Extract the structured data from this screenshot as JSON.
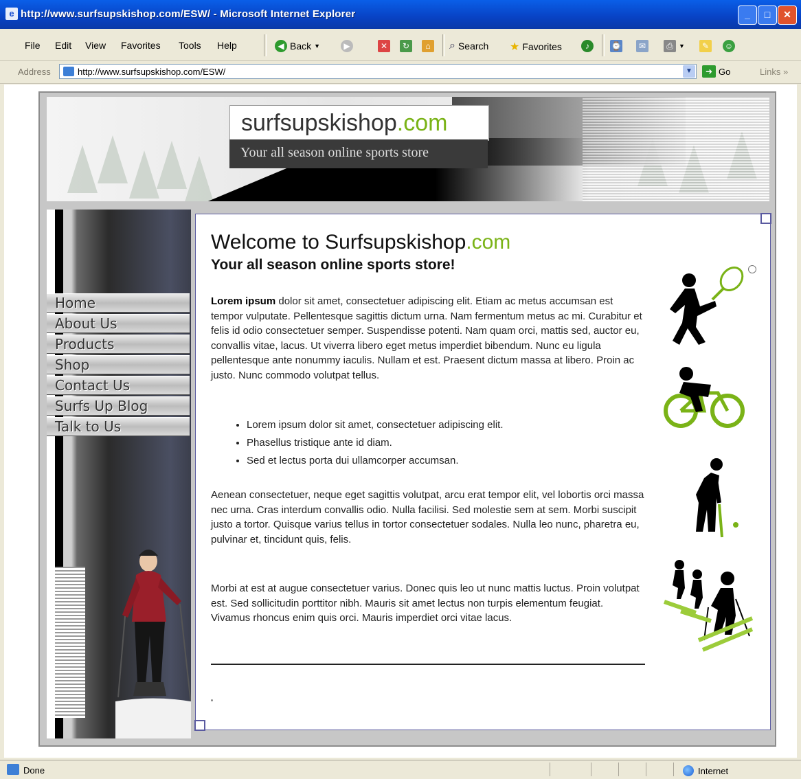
{
  "window": {
    "title": "http://www.surfsupskishop.com/ESW/ - Microsoft Internet Explorer",
    "min_symbol": "_",
    "max_symbol": "□",
    "close_symbol": "✕"
  },
  "menu": [
    "File",
    "Edit",
    "View",
    "Favorites",
    "Tools",
    "Help"
  ],
  "toolbar": {
    "back_label": "Back",
    "search_label": "Search",
    "favorites_label": "Favorites"
  },
  "address": {
    "label": "Address",
    "url": "http://www.surfsupskishop.com/ESW/",
    "go_label": "Go",
    "links_label": "Links"
  },
  "site": {
    "logo_name": "surfsupskishop",
    "logo_tld": ".com",
    "tagline": "Your all season online sports store",
    "nav": [
      "Home",
      "About Us",
      "Products",
      "Shop",
      "Contact Us",
      "Surfs Up Blog",
      "Talk to Us"
    ],
    "heading_prefix": "Welcome to Surfsupskishop",
    "heading_tld": ".com",
    "subheading": "Your all season online sports store!",
    "p1_bold": "Lorem ipsum",
    "p1_rest": " dolor sit amet, consectetuer adipiscing elit. Etiam ac metus accumsan est tempor vulputate. Pellentesque sagittis dictum urna. Nam fermentum metus ac mi. Curabitur et felis id odio consectetuer semper. Suspendisse potenti. Nam quam orci, mattis sed, auctor eu, convallis vitae, lacus. Ut viverra libero eget metus imperdiet bibendum. Nunc eu ligula pellentesque ante nonummy iaculis. Nullam et est. Praesent dictum massa at libero. Proin ac justo. Nunc commodo volutpat tellus.",
    "bullets": [
      "Lorem ipsum dolor sit amet, consectetuer adipiscing elit.",
      "Phasellus tristique ante id diam.",
      "Sed et lectus porta dui ullamcorper accumsan."
    ],
    "p2": "Aenean consectetuer, neque eget sagittis volutpat, arcu erat tempor elit, vel lobortis orci massa nec urna. Cras interdum convallis odio. Nulla facilisi. Sed molestie sem at sem. Morbi suscipit justo a tortor. Quisque varius tellus in tortor consectetuer sodales. Nulla leo nunc, pharetra eu, pulvinar et, tincidunt quis, felis.",
    "p3": "Morbi at est at augue consectetuer varius. Donec quis leo ut nunc mattis luctus. Proin volutpat est. Sed sollicitudin porttitor nibh. Mauris sit amet lectus non turpis elementum feugiat. Vivamus rhoncus enim quis orci. Mauris imperdiet orci vitae lacus."
  },
  "status": {
    "text": "Done",
    "zone": "Internet"
  },
  "colors": {
    "accent_green": "#7ab317",
    "titlebar_blue": "#0842c4",
    "frame_border": "#5a5aa0"
  },
  "icons": [
    "tennis-icon",
    "cycling-icon",
    "golf-icon",
    "skiing-icon",
    "skier-photo"
  ]
}
